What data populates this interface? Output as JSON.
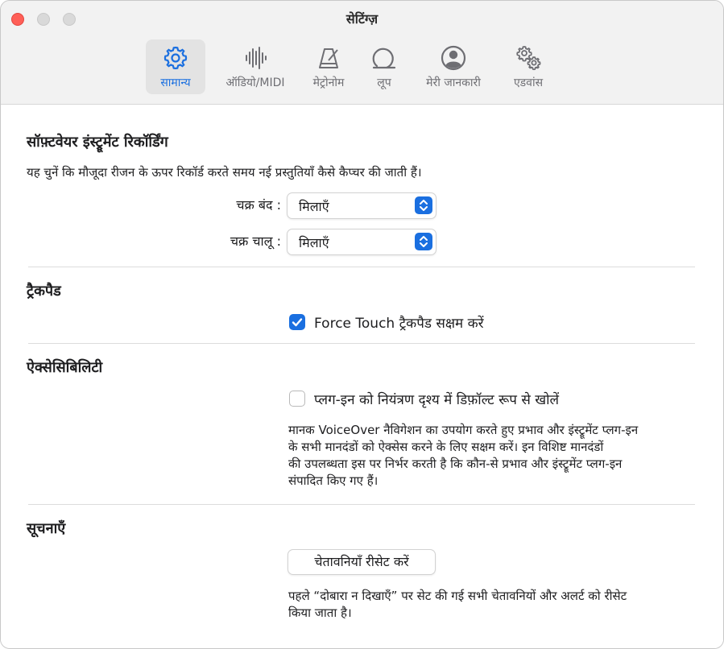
{
  "window": {
    "title": "सेटिंग्ज़"
  },
  "toolbar": {
    "tabs": [
      {
        "label": "सामान्य",
        "icon": "gear-icon",
        "active": true
      },
      {
        "label": "ऑडियो/MIDI",
        "icon": "waveform-icon",
        "active": false
      },
      {
        "label": "मेट्रोनोम",
        "icon": "metronome-icon",
        "active": false
      },
      {
        "label": "लूप",
        "icon": "loop-icon",
        "active": false
      },
      {
        "label": "मेरी जानकारी",
        "icon": "person-circle-icon",
        "active": false
      },
      {
        "label": "एडवांस",
        "icon": "gears-icon",
        "active": false
      }
    ]
  },
  "recording": {
    "title": "सॉफ़्टवेयर इंस्ट्रूमेंट रिकॉर्डिंग",
    "description": "यह चुनें कि मौजूदा रीजन के ऊपर रिकॉर्ड करते समय नई प्रस्तुतियाँ कैसे कैप्चर की जाती हैं।",
    "cycle_off_label": "चक्र बंद :",
    "cycle_off_value": "मिलाएँ",
    "cycle_on_label": "चक्र चालू :",
    "cycle_on_value": "मिलाएँ"
  },
  "trackpad": {
    "title": "ट्रैकपैड",
    "force_touch_label": "Force Touch ट्रैकपैड सक्षम करें",
    "force_touch_checked": true
  },
  "accessibility": {
    "title": "ऐक्सेसिबिलिटी",
    "plugin_label": "प्लग-इन को नियंत्रण दृश्य में डिफ़ॉल्ट रूप से खोलें",
    "plugin_checked": false,
    "desc_lines": [
      "मानक VoiceOver नैविगेशन का उपयोग करते हुए प्रभाव और इंस्ट्रूमेंट प्लग-इन",
      "के सभी मानदंडों को ऐक्सेस करने के लिए सक्षम करें। इन विशिष्ट मानदंडों",
      "की उपलब्धता इस पर निर्भर करती है कि कौन-से प्रभाव और इंस्ट्रूमेंट प्लग-इन",
      "संपादित किए गए हैं।"
    ]
  },
  "notifications": {
    "title": "सूचनाएँ",
    "reset_button": "चेतावनियाँ रीसेट करें",
    "desc_lines": [
      "पहले “दोबारा न दिखाएँ” पर सेट की गई सभी चेतावनियों और अलर्ट को रीसेट",
      "किया जाता है।"
    ]
  },
  "colors": {
    "accent": "#1a6fe0",
    "close": "#ff5f57"
  }
}
